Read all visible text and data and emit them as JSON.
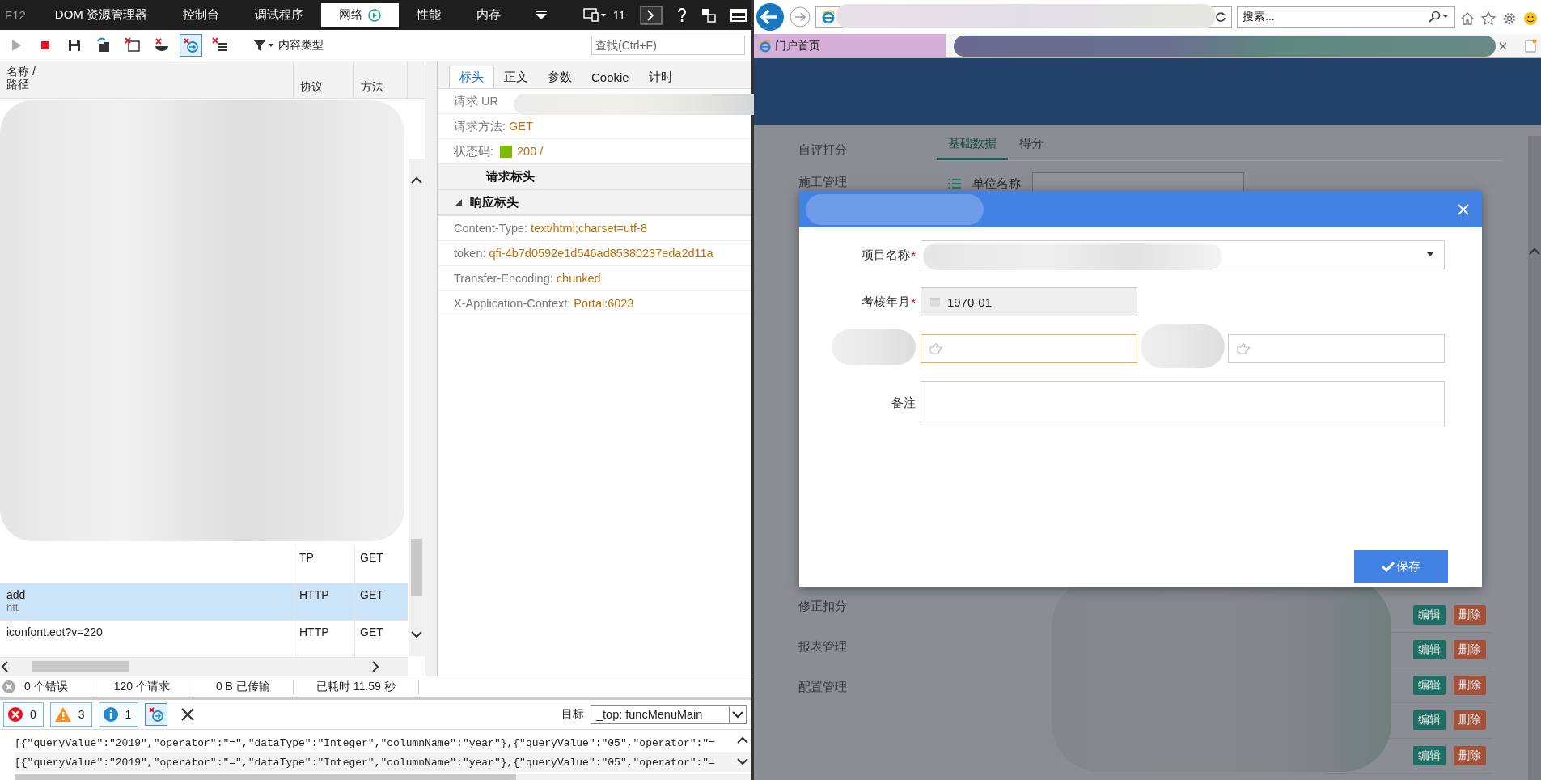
{
  "devtools": {
    "f12": "F12",
    "tabs": [
      {
        "label": "DOM 资源管理器",
        "selected": false
      },
      {
        "label": "控制台",
        "selected": false
      },
      {
        "label": "调试程序",
        "selected": false
      },
      {
        "label": "网络",
        "selected": true
      },
      {
        "label": "性能",
        "selected": false
      },
      {
        "label": "内存",
        "selected": false
      }
    ],
    "instance_count": "11",
    "filter_label": "内容类型",
    "search": {
      "placeholder": "查找(Ctrl+F)"
    },
    "request_list": {
      "columns": [
        {
          "label": "名称 /",
          "sublabel": "路径"
        },
        {
          "label": "协议"
        },
        {
          "label": "方法"
        }
      ],
      "rows": [
        {
          "protocol": "TP",
          "method": "GET",
          "selected": false
        },
        {
          "name": "add",
          "url": "htt",
          "protocol": "HTTP",
          "method": "GET",
          "selected": true
        },
        {
          "name": "iconfont.eot?v=220",
          "protocol": "HTTP",
          "method": "GET",
          "selected": false
        }
      ]
    },
    "details": {
      "tabs": [
        {
          "label": "标头",
          "selected": true
        },
        {
          "label": "正文",
          "selected": false
        },
        {
          "label": "参数",
          "selected": false
        },
        {
          "label": "Cookie",
          "selected": false
        },
        {
          "label": "计时",
          "selected": false
        }
      ],
      "rows": [
        {
          "kind": "field",
          "label": "请求 UR"
        },
        {
          "kind": "field",
          "label": "请求方法:",
          "value": "GET"
        },
        {
          "kind": "status",
          "label": "状态码:",
          "value": "200 /"
        },
        {
          "kind": "section",
          "label": "请求标头",
          "expanded": false
        },
        {
          "kind": "section",
          "label": "响应标头",
          "expanded": true
        },
        {
          "kind": "field",
          "label": "Content-Type:",
          "value": "text/html;charset=utf-8"
        },
        {
          "kind": "field",
          "label": "token:",
          "value": "qfi-4b7d0592e1d546ad85380237eda2d11a"
        },
        {
          "kind": "field",
          "label": "Transfer-Encoding:",
          "value": "chunked"
        },
        {
          "kind": "field",
          "label": "X-Application-Context:",
          "value": "Portal:6023"
        }
      ]
    },
    "status_bar": [
      "0 个错误",
      "120 个请求",
      "0 B 已传输",
      "已耗时 11.59 秒"
    ],
    "console": {
      "errors": "0",
      "warnings": "3",
      "infos": "1",
      "target_label": "目标",
      "target": "_top: funcMenuMain",
      "lines": [
        "[{\"queryValue\":\"2019\",\"operator\":\"=\",\"dataType\":\"Integer\",\"columnName\":\"year\"},{\"queryValue\":\"05\",\"operator\":\"=",
        "[{\"queryValue\":\"2019\",\"operator\":\"=\",\"dataType\":\"Integer\",\"columnName\":\"year\"},{\"queryValue\":\"05\",\"operator\":\"="
      ]
    }
  },
  "browser": {
    "search": {
      "placeholder": "搜索..."
    },
    "tab": {
      "label": "门户首页"
    },
    "page": {
      "sidebar": {
        "items": [
          "自评打分",
          "施工管理",
          "修正扣分",
          "报表管理",
          "配置管理"
        ]
      },
      "tabs": [
        {
          "label": "基础数据",
          "selected": true
        },
        {
          "label": "得分",
          "selected": false
        }
      ],
      "filter_label": "单位名称",
      "rows": [
        {
          "edit": "编辑",
          "delete": "删除"
        },
        {
          "edit": "编辑",
          "delete": "删除"
        },
        {
          "edit": "编辑",
          "delete": "删除"
        },
        {
          "edit": "编辑",
          "delete": "删除"
        },
        {
          "edit": "编辑",
          "delete": "删除"
        }
      ],
      "modal": {
        "fields": [
          {
            "kind": "select",
            "label": "项目名称",
            "required_mark": "*"
          },
          {
            "kind": "date",
            "label": "考核年月",
            "required_mark": "*",
            "value": "1970-01",
            "disabled": true
          },
          {
            "kind": "pair"
          },
          {
            "kind": "textarea",
            "label": "备注"
          }
        ],
        "save": "保存"
      }
    }
  }
}
